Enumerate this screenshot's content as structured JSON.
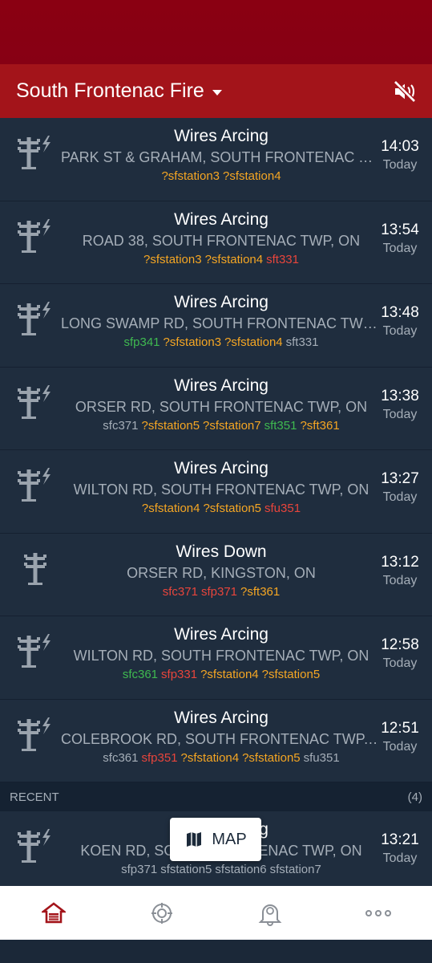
{
  "header": {
    "title": "South Frontenac Fire"
  },
  "incidents": [
    {
      "icon": "pole-spark",
      "title": "Wires Arcing",
      "address": "PARK ST & GRAHAM, SOUTH FRONTENAC TWP, ON",
      "time": "14:03",
      "day": "Today",
      "tags": [
        {
          "text": "?sfstation3",
          "color": "orange"
        },
        {
          "text": "?sfstation4",
          "color": "orange"
        }
      ]
    },
    {
      "icon": "pole-spark",
      "title": "Wires Arcing",
      "address": "ROAD 38, SOUTH FRONTENAC TWP, ON",
      "time": "13:54",
      "day": "Today",
      "tags": [
        {
          "text": "?sfstation3",
          "color": "orange"
        },
        {
          "text": "?sfstation4",
          "color": "orange"
        },
        {
          "text": "sft331",
          "color": "red"
        }
      ]
    },
    {
      "icon": "pole-spark",
      "title": "Wires Arcing",
      "address": "LONG SWAMP RD, SOUTH FRONTENAC TWP, ON",
      "time": "13:48",
      "day": "Today",
      "tags": [
        {
          "text": "sfp341",
          "color": "green"
        },
        {
          "text": "?sfstation3",
          "color": "orange"
        },
        {
          "text": "?sfstation4",
          "color": "orange"
        },
        {
          "text": "sft331",
          "color": "gray"
        }
      ]
    },
    {
      "icon": "pole-spark",
      "title": "Wires Arcing",
      "address": "ORSER RD, SOUTH FRONTENAC TWP, ON",
      "time": "13:38",
      "day": "Today",
      "tags": [
        {
          "text": "sfc371",
          "color": "gray"
        },
        {
          "text": "?sfstation5",
          "color": "orange"
        },
        {
          "text": "?sfstation7",
          "color": "orange"
        },
        {
          "text": "sft351",
          "color": "green"
        },
        {
          "text": "?sft361",
          "color": "orange"
        }
      ]
    },
    {
      "icon": "pole-spark",
      "title": "Wires Arcing",
      "address": "WILTON RD, SOUTH FRONTENAC TWP, ON",
      "time": "13:27",
      "day": "Today",
      "tags": [
        {
          "text": "?sfstation4",
          "color": "orange"
        },
        {
          "text": "?sfstation5",
          "color": "orange"
        },
        {
          "text": "sfu351",
          "color": "red"
        }
      ]
    },
    {
      "icon": "pole",
      "title": "Wires Down",
      "address": "ORSER RD, KINGSTON, ON",
      "time": "13:12",
      "day": "Today",
      "tags": [
        {
          "text": "sfc371",
          "color": "red"
        },
        {
          "text": "sfp371",
          "color": "red"
        },
        {
          "text": "?sft361",
          "color": "orange"
        }
      ]
    },
    {
      "icon": "pole-spark",
      "title": "Wires Arcing",
      "address": "WILTON RD, SOUTH FRONTENAC TWP, ON",
      "time": "12:58",
      "day": "Today",
      "tags": [
        {
          "text": "sfc361",
          "color": "green"
        },
        {
          "text": "sfp331",
          "color": "red"
        },
        {
          "text": "?sfstation4",
          "color": "orange"
        },
        {
          "text": "?sfstation5",
          "color": "orange"
        }
      ]
    },
    {
      "icon": "pole-spark",
      "title": "Wires Arcing",
      "address": "COLEBROOK RD, SOUTH FRONTENAC TWP, ON",
      "time": "12:51",
      "day": "Today",
      "tags": [
        {
          "text": "sfc361",
          "color": "gray"
        },
        {
          "text": "sfp351",
          "color": "red"
        },
        {
          "text": "?sfstation4",
          "color": "orange"
        },
        {
          "text": "?sfstation5",
          "color": "orange"
        },
        {
          "text": "sfu351",
          "color": "gray"
        }
      ]
    }
  ],
  "recent_section": {
    "label": "RECENT",
    "count": "(4)"
  },
  "recent": [
    {
      "icon": "pole-spark",
      "title": "Wires Arcing",
      "address": "KOEN RD, SOUTH FRONTENAC TWP, ON",
      "time": "13:21",
      "day": "Today",
      "tags": [
        {
          "text": "sfp371",
          "color": "gray"
        },
        {
          "text": "sfstation5",
          "color": "gray"
        },
        {
          "text": "sfstation6",
          "color": "gray"
        },
        {
          "text": "sfstation7",
          "color": "gray"
        }
      ]
    }
  ],
  "map_button": {
    "label": "MAP"
  },
  "nav": [
    {
      "icon": "home-icon"
    },
    {
      "icon": "fire-badge-icon"
    },
    {
      "icon": "alarm-bell-icon"
    },
    {
      "icon": "more-icon"
    }
  ],
  "colors": {
    "appbar": "#a3141a",
    "statusbar": "#8a0012",
    "background": "#1f2d3e",
    "accent_orange": "#f5a623",
    "accent_red": "#e8453c",
    "accent_green": "#3fb950",
    "home_active": "#a3141a"
  }
}
